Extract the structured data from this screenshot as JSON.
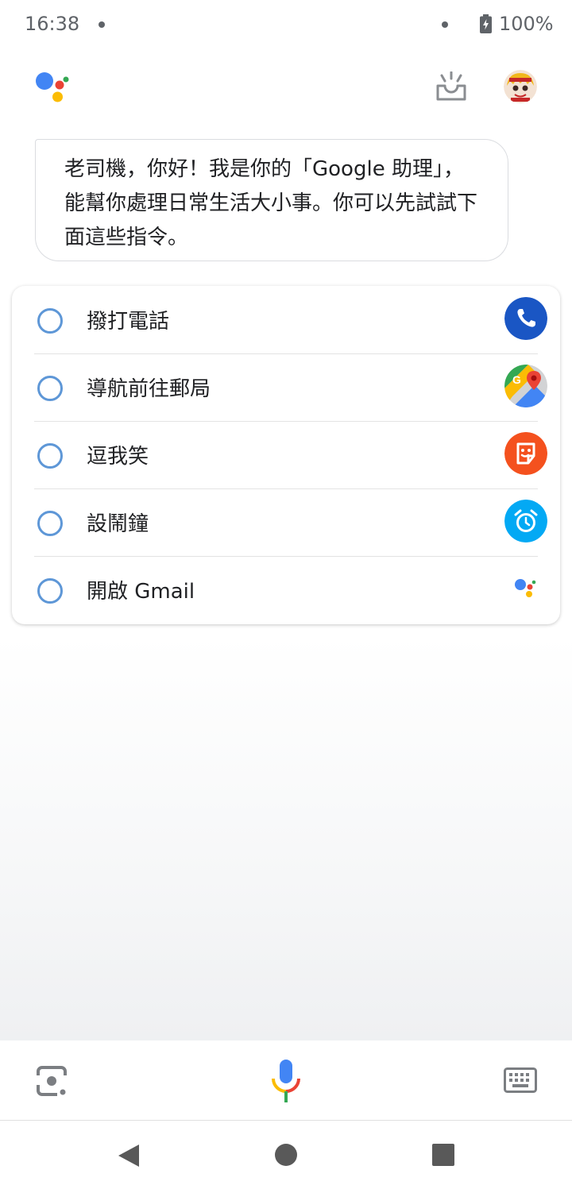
{
  "status_bar": {
    "time": "16:38",
    "battery": "100%"
  },
  "greeting": "老司機，你好！我是你的「Google 助理」，能幫你處理日常生活大小事。你可以先試試下面這些指令。",
  "suggestions": [
    {
      "label": "撥打電話",
      "icon": "phone-icon"
    },
    {
      "label": "導航前往郵局",
      "icon": "google-maps-icon"
    },
    {
      "label": "逗我笑",
      "icon": "smiley-sticker-icon"
    },
    {
      "label": "設鬧鐘",
      "icon": "alarm-clock-icon"
    },
    {
      "label": "開啟 Gmail",
      "icon": "google-assistant-dots-icon"
    }
  ],
  "colors": {
    "google_blue": "#4285f4",
    "google_red": "#ea4335",
    "google_yellow": "#fbbc04",
    "google_green": "#34a853",
    "phone_blue": "#1a56c4",
    "sticker_orange": "#f4511e",
    "alarm_blue": "#03a9f4",
    "radio_blue": "#5e97d7"
  },
  "icons": {
    "assistant_logo": "google-assistant-logo",
    "snapshot": "inbox-sunrise-icon",
    "avatar": "user-avatar",
    "lens": "google-lens-icon",
    "mic": "microphone-icon",
    "keyboard": "keyboard-icon",
    "nav_back": "back-triangle-icon",
    "nav_home": "home-circle-icon",
    "nav_recent": "recent-apps-square-icon"
  }
}
